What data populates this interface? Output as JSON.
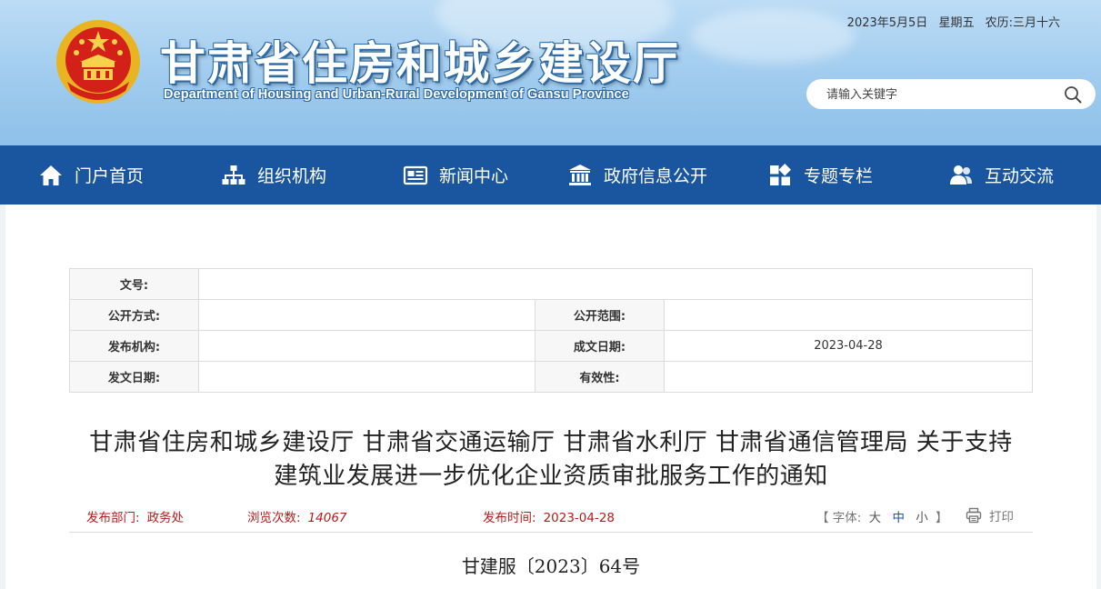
{
  "header": {
    "title": "甘肃省住房和城乡建设厅",
    "subtitle": "Department of Housing and Urban-Rural Development of Gansu Province",
    "date": "2023年5月5日",
    "weekday": "星期五",
    "lunar": "农历:三月十六",
    "search_placeholder": "请输入关键字",
    "colors": {
      "sky": "#9fcbee",
      "title_outline": "#2d6aa6"
    }
  },
  "nav": {
    "color": "#1a56a0",
    "items": [
      {
        "label": "门户首页",
        "icon": "home-icon"
      },
      {
        "label": "组织机构",
        "icon": "org-chart-icon"
      },
      {
        "label": "新闻中心",
        "icon": "newspaper-icon"
      },
      {
        "label": "政府信息公开",
        "icon": "government-building-icon"
      },
      {
        "label": "专题专栏",
        "icon": "grid-blocks-icon"
      },
      {
        "label": "互动交流",
        "icon": "people-icon"
      }
    ]
  },
  "meta_table": {
    "doc_no_label": "文号:",
    "doc_no_value": "",
    "disclosure_method_label": "公开方式:",
    "disclosure_method_value": "",
    "disclosure_scope_label": "公开范围:",
    "disclosure_scope_value": "",
    "publisher_label": "发布机构:",
    "publisher_value": "",
    "written_date_label": "成文日期:",
    "written_date_value": "2023-04-28",
    "issue_date_label": "发文日期:",
    "issue_date_value": "",
    "validity_label": "有效性:",
    "validity_value": ""
  },
  "article": {
    "title_line1": "甘肃省住房和城乡建设厅 甘肃省交通运输厅 甘肃省水利厅 甘肃省通信管理局 关于支持",
    "title_line2": "建筑业发展进一步优化企业资质审批服务工作的通知",
    "dept_label": "发布部门:",
    "dept_value": "政务处",
    "views_label": "浏览次数:",
    "views_value": "14067",
    "time_label": "发布时间:",
    "time_value": "2023-04-28",
    "font_label": "【 字体:",
    "font_large": "大",
    "font_medium": "中",
    "font_small": "小",
    "font_close": "】",
    "print_label": "打印",
    "doc_number": "甘建服〔2023〕64号",
    "accent_color": "#b51c1c"
  }
}
